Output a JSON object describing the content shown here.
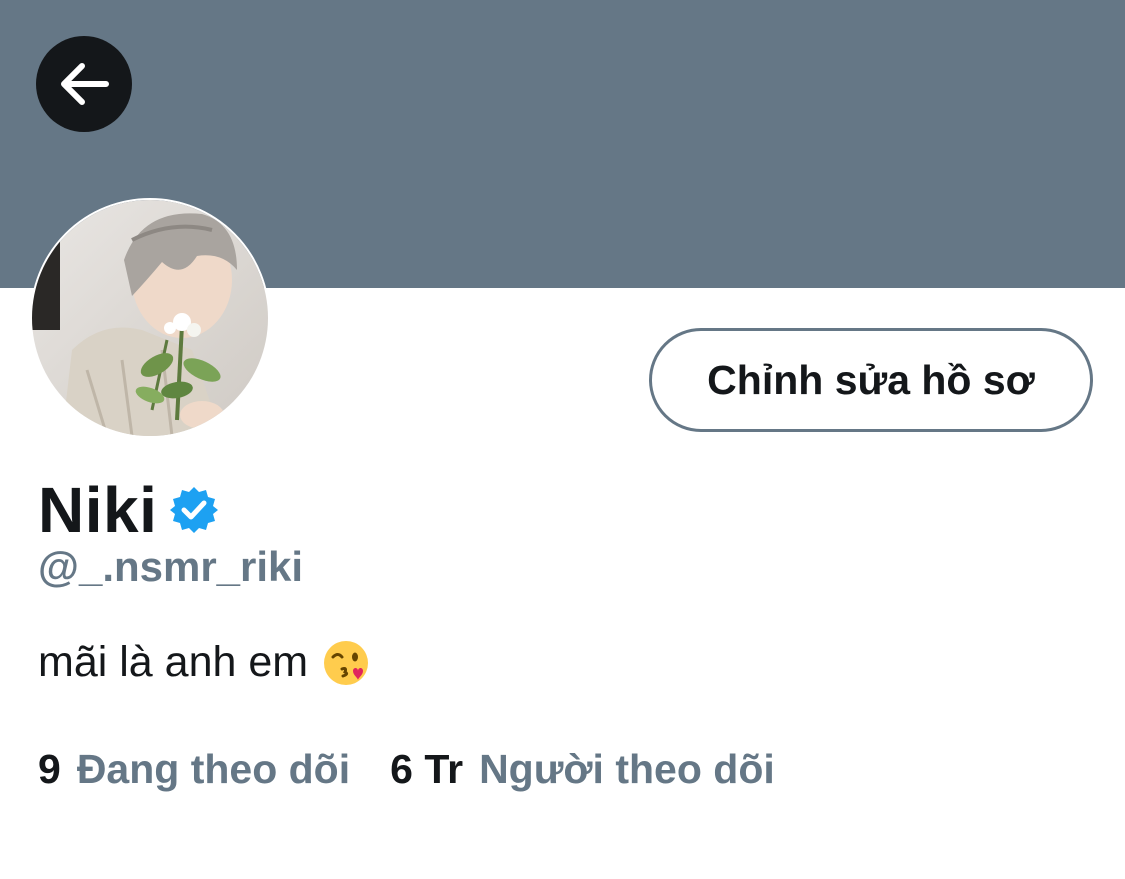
{
  "profile": {
    "display_name": "Niki",
    "handle": "@_.nsmr_riki",
    "bio": "mãi là anh em",
    "bio_emoji": "face-throwing-kiss-emoji"
  },
  "actions": {
    "edit_profile_label": "Chỉnh sửa hồ sơ",
    "back_icon": "arrow-left-icon"
  },
  "stats": {
    "following_count": "9",
    "following_label": "Đang theo dõi",
    "followers_count": "6 Tr",
    "followers_label": "Người theo dõi"
  },
  "colors": {
    "banner": "#657786",
    "verified": "#1da1f2",
    "secondary_text": "#657786",
    "primary_text": "#14171a"
  }
}
